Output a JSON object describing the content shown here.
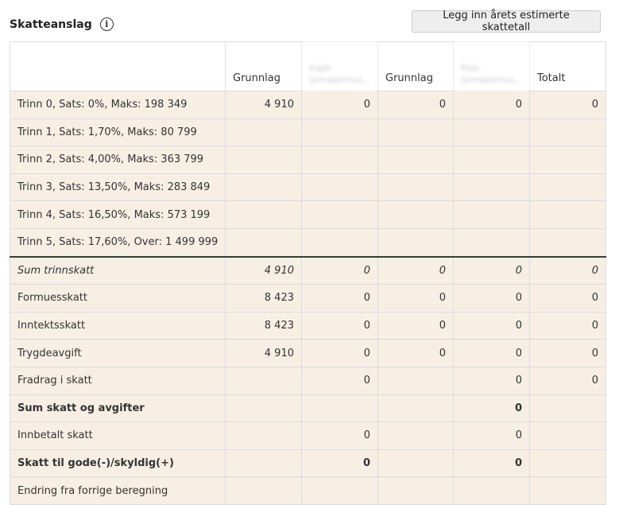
{
  "header": {
    "title": "Skatteanslag",
    "button_label": "Legg inn årets estimerte skattetall"
  },
  "table": {
    "headers": [
      "",
      "Grunnlag",
      "Inger Grindahmus...",
      "Grunnlag",
      "Rolv Grindahmus...",
      "Totalt"
    ],
    "rows": [
      {
        "label": "Trinn 0, Sats: 0%, Maks: 198 349",
        "cells": [
          "4 910",
          "0",
          "0",
          "0",
          "0"
        ]
      },
      {
        "label": "Trinn 1, Sats: 1,70%, Maks: 80 799",
        "cells": [
          "",
          "",
          "",
          "",
          ""
        ]
      },
      {
        "label": "Trinn 2, Sats: 4,00%, Maks: 363 799",
        "cells": [
          "",
          "",
          "",
          "",
          ""
        ]
      },
      {
        "label": "Trinn 3, Sats: 13,50%, Maks: 283 849",
        "cells": [
          "",
          "",
          "",
          "",
          ""
        ]
      },
      {
        "label": "Trinn 4, Sats: 16,50%, Maks: 573 199",
        "cells": [
          "",
          "",
          "",
          "",
          ""
        ]
      },
      {
        "label": "Trinn 5, Sats: 17,60%, Over: 1 499 999",
        "cells": [
          "",
          "",
          "",
          "",
          ""
        ]
      },
      {
        "label": "Sum trinnskatt",
        "cells": [
          "4 910",
          "0",
          "0",
          "0",
          "0"
        ]
      },
      {
        "label": "Formuesskatt",
        "cells": [
          "8 423",
          "0",
          "0",
          "0",
          "0"
        ]
      },
      {
        "label": "Inntektsskatt",
        "cells": [
          "8 423",
          "0",
          "0",
          "0",
          "0"
        ]
      },
      {
        "label": "Trygdeavgift",
        "cells": [
          "4 910",
          "0",
          "0",
          "0",
          "0"
        ]
      },
      {
        "label": "Fradrag i skatt",
        "cells": [
          "",
          "0",
          "",
          "0",
          "0"
        ]
      },
      {
        "label": "Sum skatt og avgifter",
        "cells": [
          "",
          "",
          "",
          "0",
          ""
        ]
      },
      {
        "label": "Innbetalt skatt",
        "cells": [
          "",
          "0",
          "",
          "0",
          ""
        ]
      },
      {
        "label": "Skatt til gode(-)/skyldig(+)",
        "cells": [
          "",
          "0",
          "",
          "0",
          ""
        ]
      },
      {
        "label": "Endring fra forrige beregning",
        "cells": [
          "",
          "",
          "",
          "",
          ""
        ]
      }
    ]
  }
}
